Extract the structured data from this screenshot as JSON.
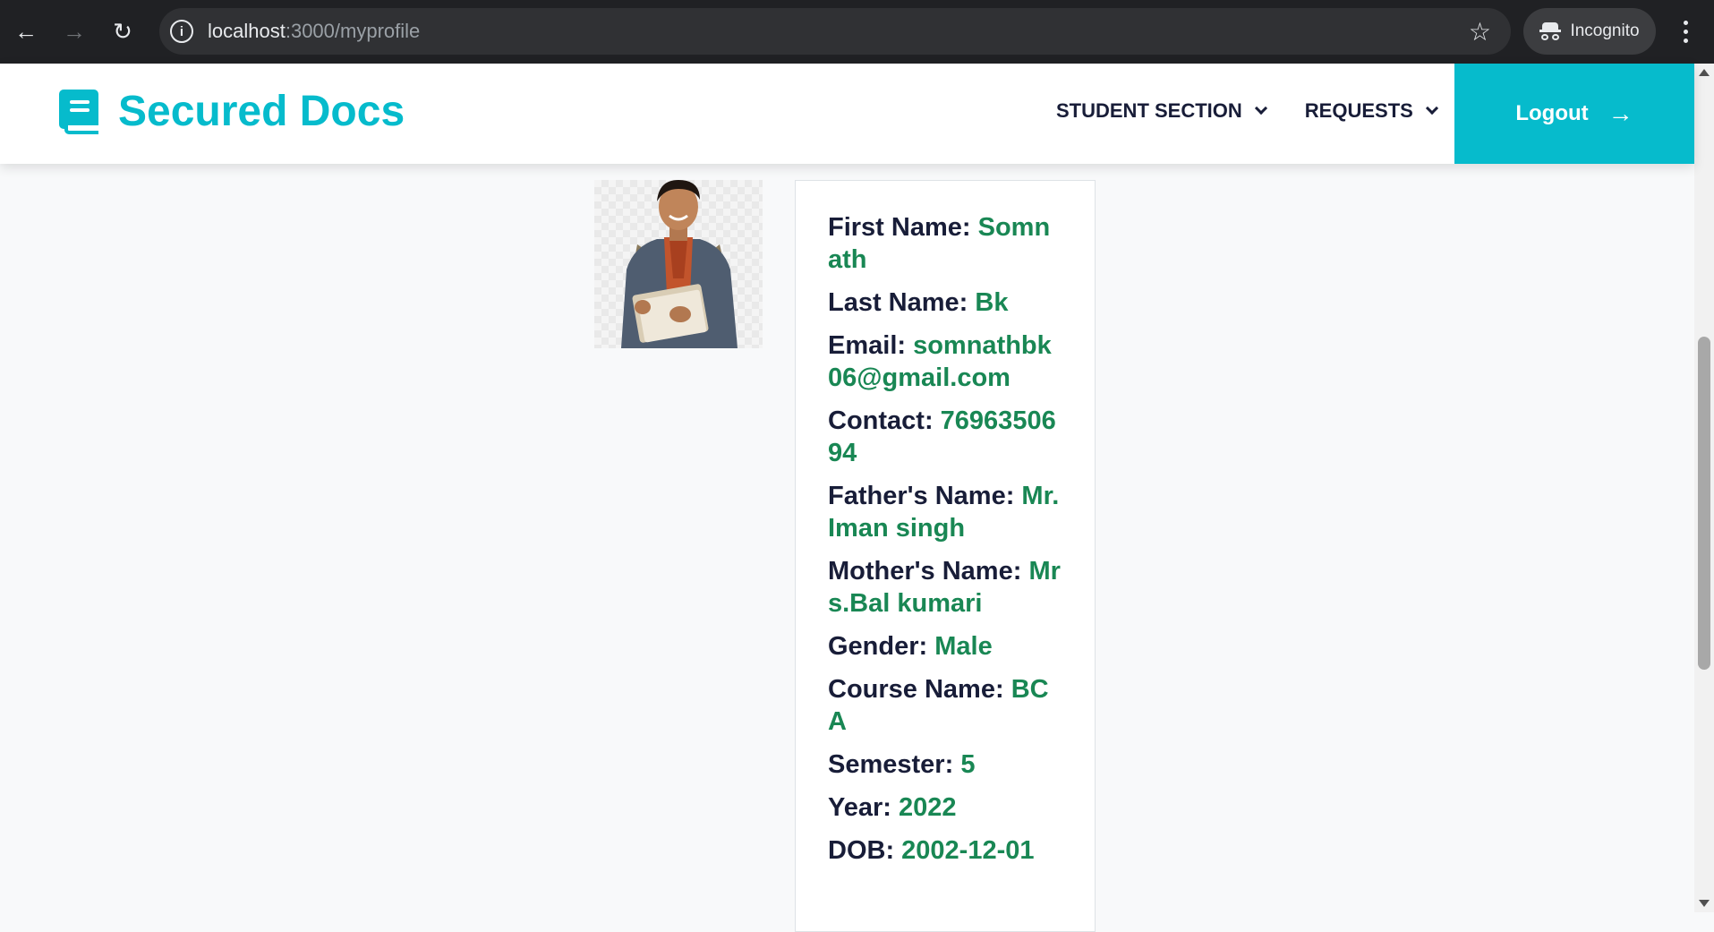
{
  "browser": {
    "url_host": "localhost",
    "url_path": ":3000/myprofile",
    "incognito_label": "Incognito"
  },
  "header": {
    "brand": "Secured Docs",
    "nav": [
      {
        "label": "STUDENT SECTION"
      },
      {
        "label": "REQUESTS"
      }
    ],
    "logout_label": "Logout"
  },
  "profile": {
    "fields": [
      {
        "label": "First Name:",
        "value": "Somnath"
      },
      {
        "label": "Last Name:",
        "value": "Bk"
      },
      {
        "label": "Email:",
        "value": "somnathbk06@gmail.com"
      },
      {
        "label": "Contact:",
        "value": "7696350694"
      },
      {
        "label": "Father's Name:",
        "value": "Mr.Iman singh"
      },
      {
        "label": "Mother's Name:",
        "value": "Mrs.Bal kumari"
      },
      {
        "label": "Gender:",
        "value": "Male"
      },
      {
        "label": "Course Name:",
        "value": "BCA"
      },
      {
        "label": "Semester:",
        "value": "5"
      },
      {
        "label": "Year:",
        "value": "2022"
      },
      {
        "label": "DOB:",
        "value": "2002-12-01"
      }
    ]
  },
  "colors": {
    "accent": "#06bbcc",
    "value_green": "#198754",
    "dark": "#181d38"
  }
}
